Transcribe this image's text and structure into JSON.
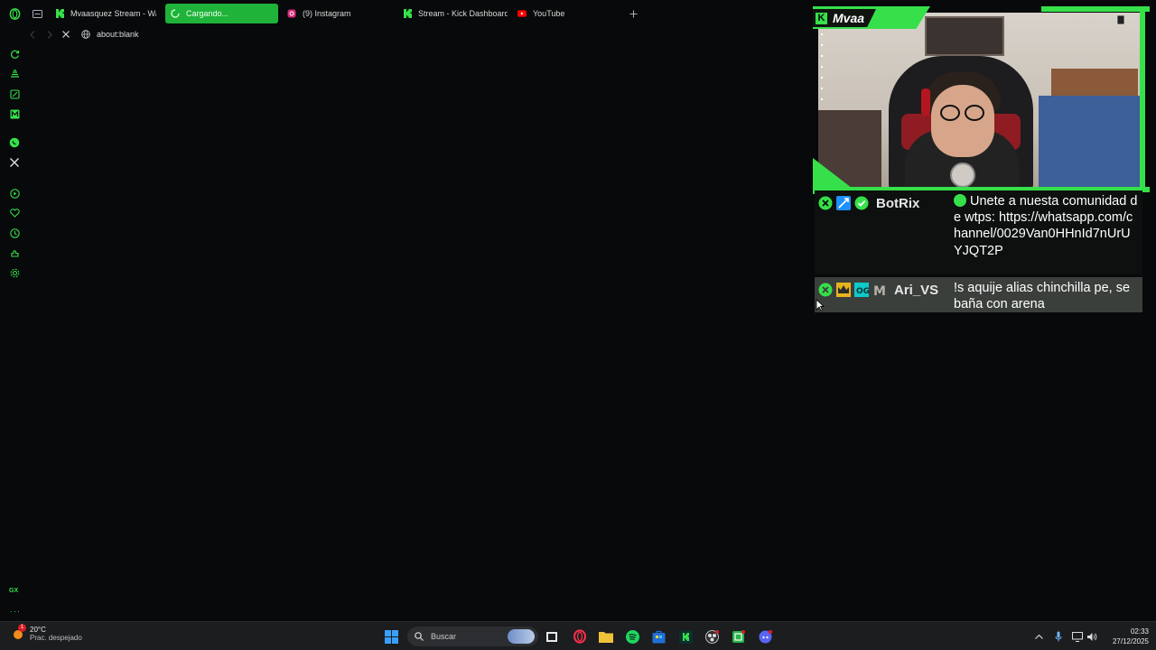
{
  "browser": {
    "tabs": [
      {
        "label": "Mvaasquez Stream - Wat",
        "icon": "kick-icon",
        "active": false
      },
      {
        "label": "Cargando...",
        "icon": "loading-icon",
        "active": true
      },
      {
        "label": "(9) Instagram",
        "icon": "instagram-icon",
        "active": false
      },
      {
        "label": "Stream - Kick Dashboard",
        "icon": "kick-icon",
        "active": false
      },
      {
        "label": "YouTube",
        "icon": "youtube-icon",
        "active": false
      }
    ],
    "address": "about:blank",
    "accent_color": "#1fb33a"
  },
  "overlay": {
    "channel": "Mvaa",
    "brand_color": "#36e04a"
  },
  "chat": {
    "messages": [
      {
        "user": "BotRix",
        "text": "Unete a nuesta comunidad de wtps: https://whatsapp.com/channel/0029Van0HHnId7nUrUYJQT2P"
      },
      {
        "user": "Ari_VS",
        "text": "!s aquije alias chinchilla pe, se baña con arena"
      }
    ]
  },
  "sidebar": {
    "footer_label": "GX"
  },
  "taskbar": {
    "weather_temp": "20°C",
    "weather_desc": "Prac. despejado",
    "weather_badge": "1",
    "search_placeholder": "Buscar",
    "time": "02:33",
    "date": "27/12/2025"
  }
}
